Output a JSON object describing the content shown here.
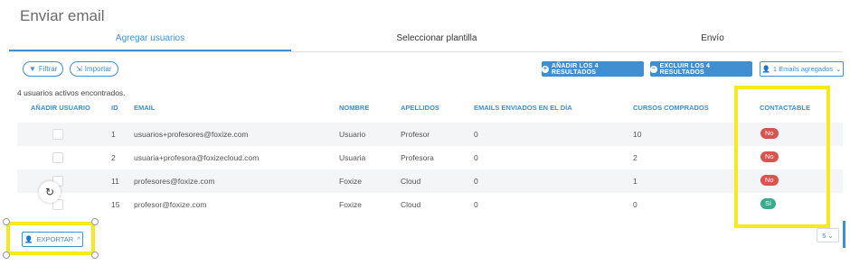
{
  "page": {
    "title": "Enviar email"
  },
  "tabs": [
    {
      "label": "Agregar usuarios",
      "active": true
    },
    {
      "label": "Seleccionar plantilla"
    },
    {
      "label": "Envío"
    }
  ],
  "toolbar": {
    "filter_label": "Filtrar",
    "import_label": "Importar",
    "add_all_label": "AÑADIR LOS 4 RESULTADOS",
    "exclude_all_label": "EXCLUIR LOS 4 RESULTADOS",
    "added_label": "1 Emails agregados"
  },
  "results_count": "4 usuarios activos encontrados.",
  "table": {
    "headers": {
      "add": "AÑADIR USUARIO",
      "id": "ID",
      "email": "EMAIL",
      "nombre": "NOMBRE",
      "apellidos": "APELLIDOS",
      "enviados": "EMAILS ENVIADOS EN EL DÍA",
      "cursos": "CURSOS COMPRADOS",
      "contactable": "CONTACTABLE"
    },
    "rows": [
      {
        "id": "1",
        "email": "usuarios+profesores@foxize.com",
        "nombre": "Usuario",
        "apellidos": "Profesor",
        "enviados": "0",
        "cursos": "10",
        "contactable": "No"
      },
      {
        "id": "2",
        "email": "usuaria+profesora@foxizecloud.com",
        "nombre": "Usuaria",
        "apellidos": "Profesora",
        "enviados": "0",
        "cursos": "2",
        "contactable": "No"
      },
      {
        "id": "11",
        "email": "profesores@foxize.com",
        "nombre": "Foxize",
        "apellidos": "Cloud",
        "enviados": "0",
        "cursos": "1",
        "contactable": "No"
      },
      {
        "id": "15",
        "email": "profesor@foxize.com",
        "nombre": "Foxize",
        "apellidos": "Cloud",
        "enviados": "0",
        "cursos": "0",
        "contactable": "Sí"
      }
    ]
  },
  "footer": {
    "export_label": "EXPORTAR",
    "page_size": "5"
  },
  "colors": {
    "accent": "#3f8fd2",
    "badge_no": "#d9534f",
    "badge_si": "#3aaa8c",
    "highlight": "#f7ea1c"
  },
  "icons": [
    "filter-icon",
    "import-icon",
    "plus-circle-icon",
    "minus-circle-icon",
    "user-icon",
    "chevron-down-icon",
    "export-user-icon",
    "chevron-up-icon",
    "rotate-icon"
  ]
}
